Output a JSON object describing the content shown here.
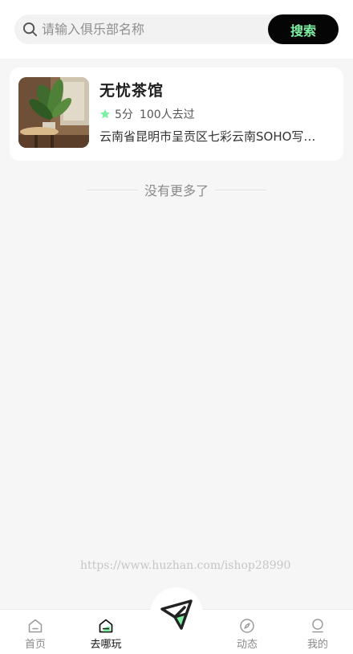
{
  "search": {
    "placeholder": "请输入俱乐部名称",
    "button_label": "搜索"
  },
  "club": {
    "name": "无忧茶馆",
    "score": "5分",
    "visitors": "100人去过",
    "address": "云南省昆明市呈贡区七彩云南SOHO写字楼"
  },
  "list": {
    "end_text": "没有更多了"
  },
  "watermark": "https://www.huzhan.com/ishop28990",
  "tabbar": {
    "items": [
      {
        "label": "首页",
        "icon": "home-icon"
      },
      {
        "label": "去哪玩",
        "icon": "explore-home-icon"
      },
      {
        "label": "动态",
        "icon": "compass-icon"
      },
      {
        "label": "我的",
        "icon": "user-icon"
      }
    ],
    "active_index": 1,
    "center_icon": "send-icon"
  },
  "colors": {
    "accent_green": "#7ef0a4",
    "dark": "#050505",
    "background": "#f6f6f6"
  }
}
